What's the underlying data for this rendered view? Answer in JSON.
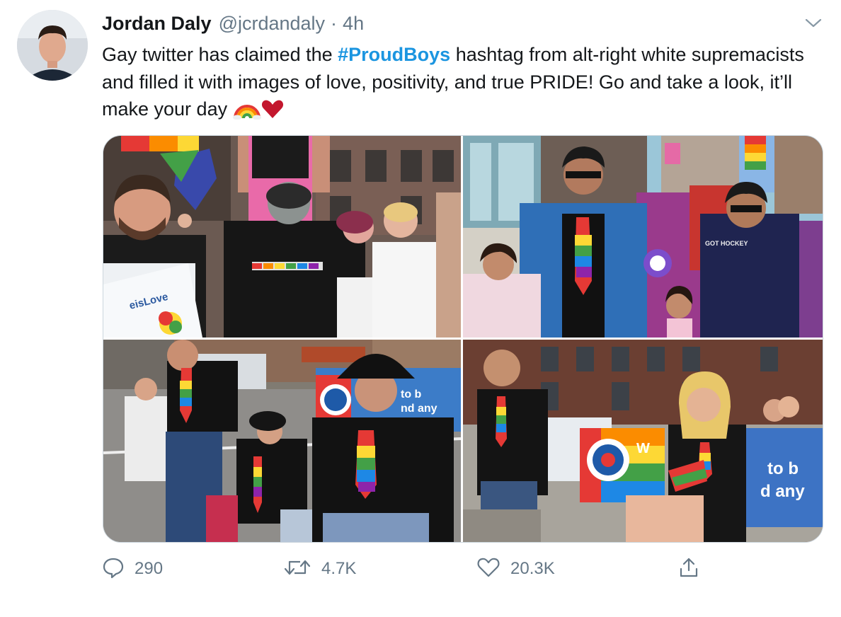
{
  "tweet": {
    "author_name": "Jordan Daly",
    "handle": "@jcrdandaly",
    "separator": "·",
    "time": "4h",
    "text_part1": "Gay twitter has claimed the ",
    "hashtag": "#ProudBoys",
    "text_part2": " hashtag from alt-right white supremacists and filled it with images of love, positivity, and true PRIDE! Go and take a look, it’ll make your day"
  },
  "photos": {
    "sign_text": "eisLove",
    "shirt_text_1": "GOT HOCKEY",
    "banner_text_1": "to b",
    "banner_text_2": "nd any",
    "banner_text_3": "to b",
    "banner_text_4": "d any",
    "banner_text_5": "W"
  },
  "actions": {
    "reply_count": "290",
    "retweet_count": "4.7K",
    "like_count": "20.3K"
  },
  "colors": {
    "link": "#1b95e0",
    "secondary": "#657786",
    "heart": "#c3172e"
  },
  "icons": [
    "chevron-down-icon",
    "rainbow-icon",
    "heart-icon",
    "reply-icon",
    "retweet-icon",
    "like-icon",
    "share-icon"
  ]
}
